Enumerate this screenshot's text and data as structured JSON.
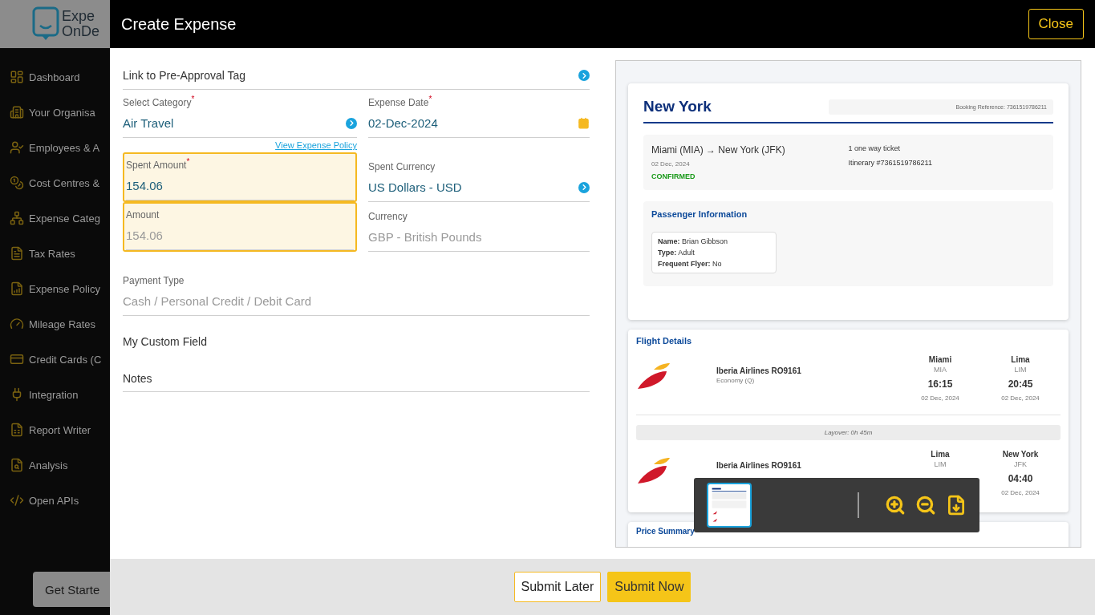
{
  "sidebar": {
    "logo": [
      "Expe",
      "OnDe"
    ],
    "items": [
      {
        "label": "Dashboard"
      },
      {
        "label": "Your Organisa"
      },
      {
        "label": "Employees & A"
      },
      {
        "label": "Cost Centres &"
      },
      {
        "label": "Expense Categ"
      },
      {
        "label": "Tax Rates"
      },
      {
        "label": "Expense Policy"
      },
      {
        "label": "Mileage Rates"
      },
      {
        "label": "Credit Cards (C"
      },
      {
        "label": "Integration"
      },
      {
        "label": "Report Writer"
      },
      {
        "label": "Analysis"
      },
      {
        "label": "Open APIs"
      }
    ],
    "get_started": "Get Starte"
  },
  "modal": {
    "title": "Create Expense",
    "close": "Close"
  },
  "form": {
    "pre_approval": {
      "label": "Link to Pre-Approval Tag"
    },
    "category": {
      "label": "Select Category",
      "required_mark": "*",
      "value": "Air Travel"
    },
    "expense_date": {
      "label": "Expense Date",
      "required_mark": "*",
      "value": "02-Dec-2024"
    },
    "policy_link": "View Expense Policy",
    "spent_amount": {
      "label": "Spent Amount",
      "required_mark": "*",
      "value": "154.06",
      "highlighted": true,
      "disabled": false
    },
    "spent_currency": {
      "label": "Spent Currency",
      "value": "US Dollars - USD",
      "disabled": false
    },
    "amount": {
      "label": "Amount",
      "value": "154.06",
      "highlighted": true,
      "disabled": true
    },
    "currency": {
      "label": "Currency",
      "value": "GBP - British Pounds",
      "disabled": true
    },
    "payment_type": {
      "label": "Payment Type",
      "value": "Cash / Personal Credit / Debit Card",
      "disabled": true
    },
    "custom_field": {
      "label": "My Custom Field"
    },
    "notes": {
      "label": "Notes"
    }
  },
  "document": {
    "title": "New York",
    "booking_reference": "Booking Reference: 7361519786211",
    "trip": {
      "route": "Miami (MIA) → New York (JFK)",
      "date": "02 Dec, 2024",
      "status": "CONFIRMED",
      "ticket": "1 one way ticket",
      "itinerary": "Itinerary #7361519786211"
    },
    "passenger": {
      "heading": "Passenger Information",
      "lines": [
        "**Name:** Brian Gibbson",
        "**Type:** Adult",
        "**Frequent Flyer:** No"
      ]
    },
    "flights": {
      "heading": "Flight Details",
      "layover": "Layover: 0h 45m",
      "legs": [
        {
          "airline": "Iberia Airlines RO9161",
          "cabin": "Economy (Q)",
          "from": {
            "city": "Miami",
            "code": "MIA",
            "time": "16:15",
            "date": "02 Dec, 2024"
          },
          "to": {
            "city": "Lima",
            "code": "LIM",
            "time": "20:45",
            "date": "02 Dec, 2024"
          }
        },
        {
          "airline": "Iberia Airlines RO9161",
          "from": {
            "city": "Lima",
            "code": "LIM"
          },
          "to": {
            "city": "New York",
            "code": "JFK",
            "time": "04:40",
            "date": "02 Dec, 2024"
          }
        }
      ]
    },
    "price_heading": "Price Summary"
  },
  "viewer": {
    "thumbnails": [
      {
        "selected": true
      }
    ]
  },
  "footer": {
    "buttons": [
      {
        "label": "Submit Later",
        "kind": "secondary"
      },
      {
        "label": "Submit Now",
        "kind": "primary"
      }
    ]
  }
}
